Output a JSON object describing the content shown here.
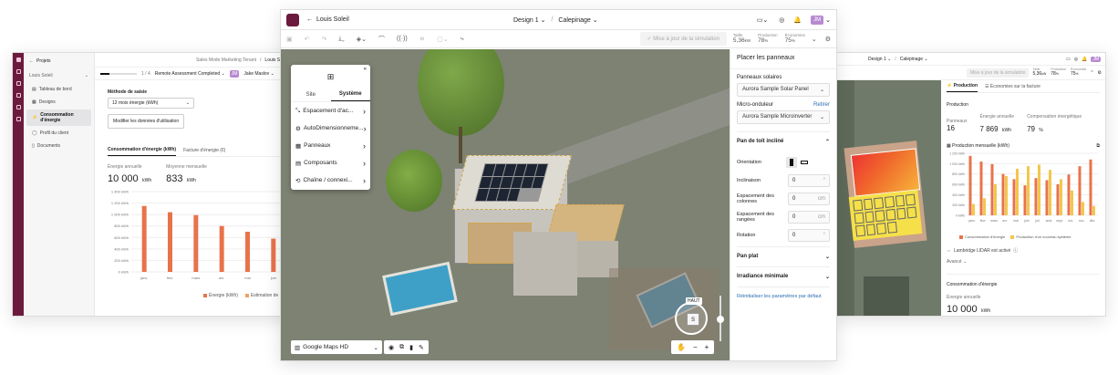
{
  "left_window": {
    "back_label": "Projets",
    "tenant": "Sales Mode Marketing Tenant",
    "breadcrumb_sep": "/",
    "project_name": "Louis Soleil",
    "status_text": "Remote Assessment Completed",
    "progress_text": "1 / 4",
    "progress_fraction": 0.25,
    "user_initials": "JM",
    "user_name": "Jake Maslov",
    "project_selector": "Louis Soleil",
    "sidebar_items": [
      {
        "label": "Tableau de bord",
        "icon": "dashboard-icon"
      },
      {
        "label": "Designs",
        "icon": "layers-icon"
      },
      {
        "label": "Consommation d'énergie",
        "icon": "energy-icon"
      },
      {
        "label": "Profil du client",
        "icon": "user-icon"
      },
      {
        "label": "Documents",
        "icon": "document-icon"
      }
    ],
    "method_label": "Méthode de saisie",
    "method_value": "12 mois énergie (kWh)",
    "modify_button": "Modifier les données d'utilisation",
    "tabs": [
      "Consommation d'énergie (kWh)",
      "Facture d'énergie (€)"
    ],
    "annual_label": "Énergie annuelle",
    "annual_value": "10 000",
    "annual_unit": "kWh",
    "monthly_label": "Moyenne mensuelle",
    "monthly_value": "833",
    "monthly_unit": "kWh",
    "legend": [
      "Énergie (kWh)",
      "Estimation de"
    ],
    "chart_data": {
      "type": "bar",
      "categories": [
        "janv.",
        "févr.",
        "mars",
        "avr.",
        "mai",
        "juin"
      ],
      "values": [
        1150,
        1040,
        990,
        800,
        700,
        580
      ],
      "ylim": [
        0,
        1400
      ],
      "ytick_labels": [
        "0 kWh",
        "200 kWh",
        "400 kWh",
        "600 kWh",
        "800 kWh",
        "1 000 kWh",
        "1 200 kWh",
        "1 400 kWh"
      ],
      "color": "#e8734a"
    }
  },
  "main_window": {
    "project_name": "Louis Soleil",
    "design_label": "Design 1",
    "breadcrumb_sep": "/",
    "view_label": "Calepinage",
    "user_initials": "JM",
    "simulation_button": "Mise à jour de la simulation",
    "stats": [
      {
        "label": "Taille",
        "value": "5,36",
        "unit": "kW"
      },
      {
        "label": "Production",
        "value": "78",
        "unit": "%"
      },
      {
        "label": "Économies",
        "value": "75",
        "unit": "%"
      }
    ],
    "menu": {
      "tabs": [
        "Site",
        "Système"
      ],
      "active_tab": "Système",
      "items": [
        {
          "label": "Espacement d'ac...",
          "icon": "spacing-icon"
        },
        {
          "label": "AutoDimensionneme...",
          "icon": "auto-icon"
        },
        {
          "label": "Panneaux",
          "icon": "panels-icon"
        },
        {
          "label": "Composants",
          "icon": "components-icon"
        },
        {
          "label": "Chaîne / connexi...",
          "icon": "string-icon"
        }
      ]
    },
    "map_source": "Google Maps HD",
    "compass_label": "HAUT",
    "compass_face": "S",
    "panel": {
      "title": "Placer les panneaux",
      "solar_panels_label": "Panneaux solaires",
      "solar_panels_value": "Aurora Sample Solar Panel",
      "inverter_label": "Micro-onduleur",
      "inverter_action": "Retirer",
      "inverter_value": "Aurora Sample Microinverter",
      "tilted_section": "Pan de toit incliné",
      "orientation_label": "Orientation",
      "tilt_label": "Inclinaison",
      "tilt_value": "0",
      "tilt_unit": "°",
      "col_spacing_label": "Espacement des colonnes",
      "col_spacing_value": "0",
      "col_spacing_unit": "cm",
      "row_spacing_label": "Espacement des rangées",
      "row_spacing_value": "0",
      "row_spacing_unit": "cm",
      "rotation_label": "Rotation",
      "rotation_value": "0",
      "rotation_unit": "°",
      "flat_section": "Pan plat",
      "irradiance_section": "Irradiance minimale",
      "reset_link": "Réinitialiser les paramètres par défaut"
    }
  },
  "right_window": {
    "design_label": "Design 1",
    "view_label": "Calepinage",
    "simulation_button": "Mise à jour de la simulation",
    "stats": [
      {
        "label": "Taille",
        "value": "5,36",
        "unit": "kW"
      },
      {
        "label": "Production",
        "value": "78",
        "unit": "%"
      },
      {
        "label": "Économies",
        "value": "75",
        "unit": "%"
      }
    ],
    "tabs": [
      "Production",
      "Économies sur la facture"
    ],
    "production_title": "Production",
    "panels_label": "Panneaux",
    "panels_value": "16",
    "annual_energy_label": "Énergie annuelle",
    "annual_energy_value": "7 869",
    "annual_energy_unit": "kWh",
    "consumption_label": "Compensation énergétique",
    "consumption_value": "79",
    "consumption_unit": "%",
    "monthly_title": "Production mensuelle (kWh)",
    "legend": [
      "Consommation d'énergie",
      "Production d'un nouveau système"
    ],
    "ldh_label": "Lambridge LIDAR est activé",
    "avance_label": "Avancé",
    "energy_title": "Consommation d'énergie",
    "energy_annual_label": "Énergie annuelle",
    "energy_annual_value": "10 000",
    "energy_annual_unit": "kWh",
    "chart_data": {
      "type": "bar",
      "categories": [
        "janv.",
        "févr.",
        "mars",
        "avr.",
        "mai",
        "juin",
        "juil.",
        "août",
        "sept.",
        "oct.",
        "nov.",
        "déc."
      ],
      "series": [
        {
          "name": "Consommation d'énergie",
          "values": [
            1150,
            1040,
            990,
            800,
            700,
            580,
            720,
            680,
            600,
            790,
            950,
            1080
          ],
          "color": "#e8734a"
        },
        {
          "name": "Production d'un nouveau système",
          "values": [
            220,
            330,
            600,
            760,
            900,
            950,
            980,
            880,
            700,
            480,
            260,
            180
          ],
          "color": "#f2c74a"
        }
      ],
      "ylim": [
        0,
        1200
      ],
      "ytick_labels": [
        "0 kWh",
        "200 kWh",
        "400 kWh",
        "600 kWh",
        "800 kWh",
        "1 000 kWh",
        "1 200 kWh"
      ]
    }
  }
}
